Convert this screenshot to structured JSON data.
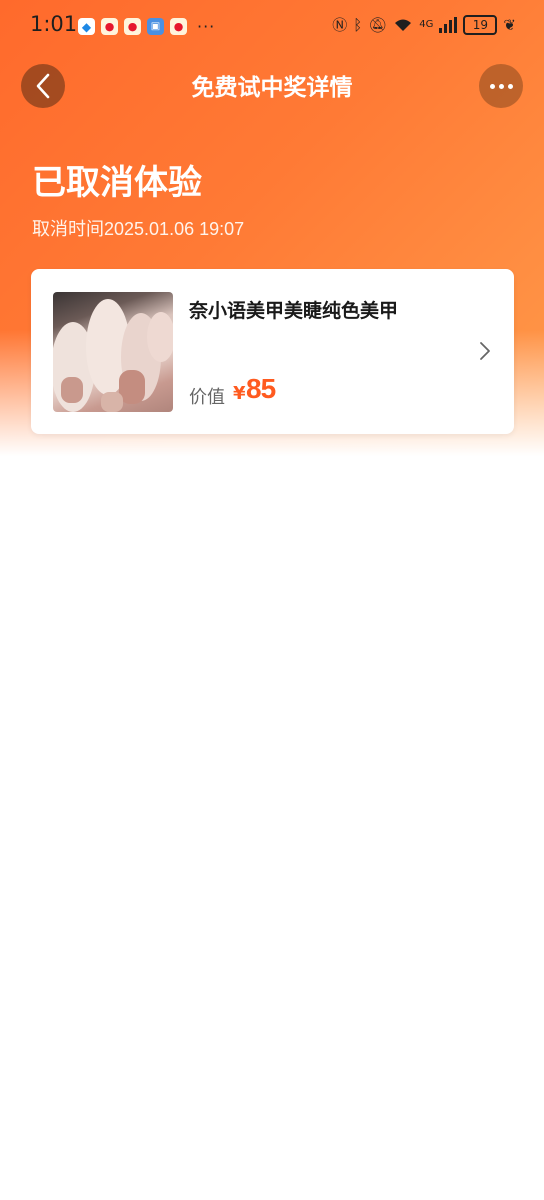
{
  "status_bar": {
    "time": "1:01",
    "more": "···",
    "battery": "19",
    "network": "4G"
  },
  "nav": {
    "title": "免费试中奖详情"
  },
  "status": {
    "title": "已取消体验",
    "cancel_time": "取消时间2025.01.06 19:07"
  },
  "product": {
    "name": "奈小语美甲美睫纯色美甲",
    "value_label": "价值",
    "currency": "¥",
    "price": "85"
  },
  "colors": {
    "accent": "#ff5a1f",
    "header_gradient_start": "#ff6a2c",
    "header_gradient_end": "#ff9a4a"
  }
}
